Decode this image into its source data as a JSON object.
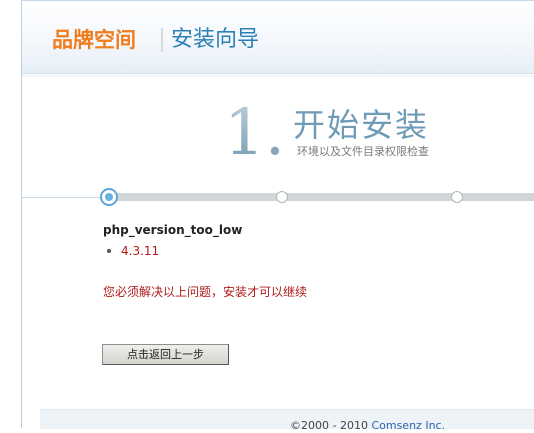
{
  "header": {
    "brand": "品牌空间",
    "wizard_title": "安装向导"
  },
  "step": {
    "number": "1.",
    "title": "开始安装",
    "subtitle": "环境以及文件目录权限检查"
  },
  "progress": {
    "current_step": 1,
    "visible_steps": 3
  },
  "errors": {
    "title": "php_version_too_low",
    "items": [
      "4.3.11"
    ]
  },
  "message": "您必须解决以上问题，安装才可以继续",
  "buttons": {
    "back_label": "点击返回上一步"
  },
  "footer": {
    "copyright": "©2000 - 2010 ",
    "company": "Comsenz Inc."
  },
  "colors": {
    "brand_orange": "#f07c1d",
    "title_blue": "#2b80b6",
    "error_red": "#b01a1a",
    "active_step": "#64b3e2"
  }
}
